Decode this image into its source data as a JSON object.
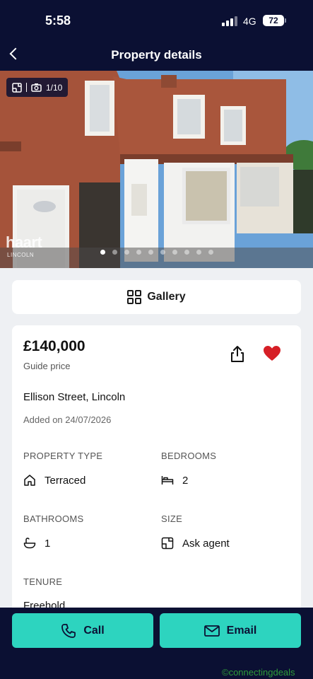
{
  "status_bar": {
    "time": "5:58",
    "network": "4G",
    "battery": "72"
  },
  "header": {
    "title": "Property details",
    "back_icon": "chevron-left-icon"
  },
  "photo": {
    "counter": "1/10",
    "logo_text": "haart",
    "logo_sub": "LINCOLN",
    "slide_count": 10,
    "active_slide": 0
  },
  "gallery": {
    "label": "Gallery",
    "icon": "grid-icon"
  },
  "listing": {
    "price": "£140,000",
    "price_qualifier": "Guide price",
    "address": "Ellison Street, Lincoln",
    "added": "Added on 24/07/2026",
    "favourited": true,
    "attributes": {
      "property_type": {
        "label": "PROPERTY TYPE",
        "value": "Terraced",
        "icon": "house-icon"
      },
      "bedrooms": {
        "label": "BEDROOMS",
        "value": "2",
        "icon": "bed-icon"
      },
      "bathrooms": {
        "label": "BATHROOMS",
        "value": "1",
        "icon": "bath-icon"
      },
      "size": {
        "label": "SIZE",
        "value": "Ask agent",
        "icon": "floorplan-icon"
      },
      "tenure": {
        "label": "TENURE",
        "value": "Freehold"
      }
    }
  },
  "actions": {
    "call_label": "Call",
    "email_label": "Email"
  },
  "watermark": "©connectingdeals",
  "colors": {
    "navy": "#0b1033",
    "accent": "#2dd4bf",
    "heart": "#d61f26"
  }
}
